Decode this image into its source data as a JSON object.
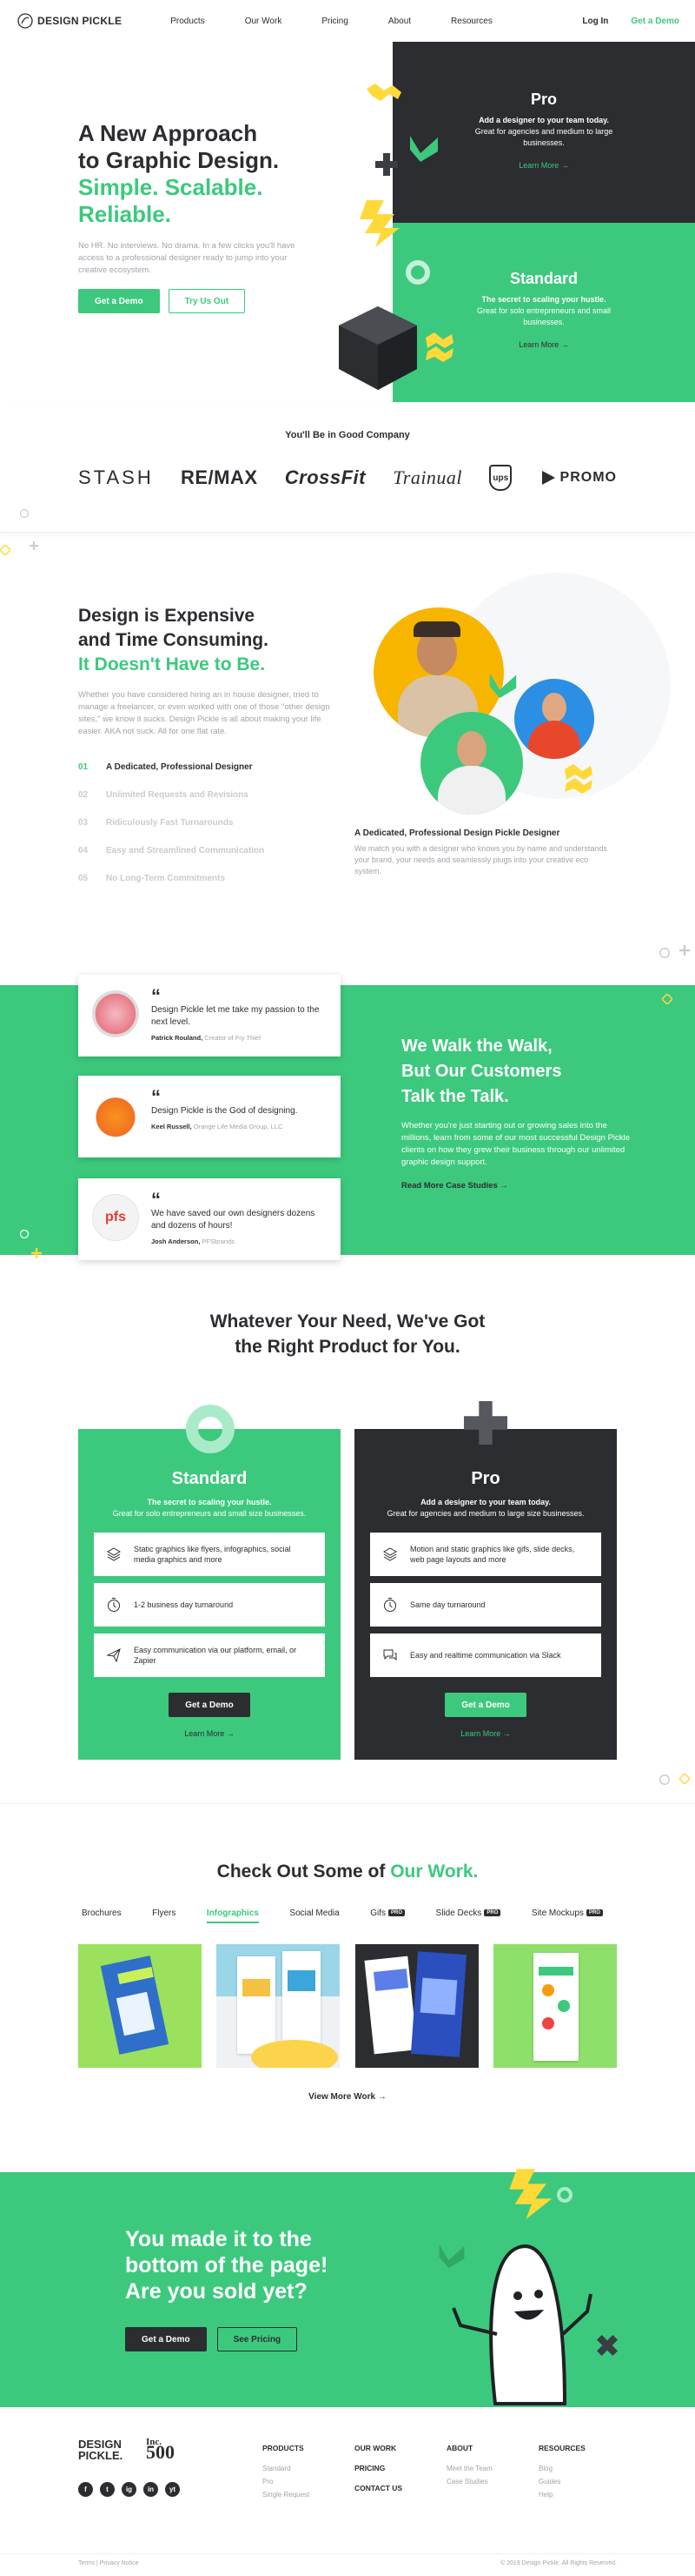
{
  "header": {
    "logo_text": "DESIGN PICKLE",
    "nav": [
      "Products",
      "Our Work",
      "Pricing",
      "About",
      "Resources"
    ],
    "login": "Log In",
    "get_demo": "Get a Demo"
  },
  "hero": {
    "title_line1": "A New Approach",
    "title_line2": "to Graphic Design.",
    "title_line3": "Simple. Scalable.",
    "title_line4": "Reliable.",
    "description": "No HR. No interviews. No drama. In a few clicks you'll have access to a professional designer ready to jump into your creative ecosystem.",
    "btn_demo": "Get a Demo",
    "btn_try": "Try Us Out",
    "pro": {
      "title": "Pro",
      "subtitle": "Add a designer to your team today.",
      "desc": "Great for agencies and medium to large businesses.",
      "link": "Learn More →"
    },
    "standard": {
      "title": "Standard",
      "subtitle": "The secret to scaling your hustle.",
      "desc": "Great for solo entrepreneurs and small businesses.",
      "link": "Learn More →"
    }
  },
  "company": {
    "heading": "You'll Be in Good Company",
    "logos": [
      "STASH",
      "RE/MAX",
      "CrossFit",
      "Trainual",
      "ups",
      "PROMO"
    ]
  },
  "expensive": {
    "title_line1": "Design is Expensive",
    "title_line2": "and Time Consuming.",
    "title_line3": "It Doesn't Have to Be.",
    "body": "Whether you have considered hiring an in house designer, tried to manage a freelancer, or even worked with one of those \"other design sites,\" we know it sucks. Design Pickle is all about making your life easier. AKA not suck. All for one flat rate.",
    "items": [
      {
        "num": "01",
        "text": "A Dedicated, Professional Designer"
      },
      {
        "num": "02",
        "text": "Unlimited Requests and Revisions"
      },
      {
        "num": "03",
        "text": "Ridiculously Fast Turnarounds"
      },
      {
        "num": "04",
        "text": "Easy and Streamlined Communication"
      },
      {
        "num": "05",
        "text": "No Long-Term Commitments"
      }
    ],
    "feature_title": "A Dedicated, Professional Design Pickle Designer",
    "feature_desc": "We match you with a designer who knows you by name and understands your brand, your needs and seamlessly plugs into your creative eco system."
  },
  "testimonials": [
    {
      "quote_mark": "“",
      "text": "Design Pickle let me take my passion to the next level.",
      "name": "Patrick Rouland,",
      "role": "Creator of Fry Thief"
    },
    {
      "quote_mark": "“",
      "text": "Design Pickle is the God of designing.",
      "name": "Keel Russell,",
      "role": "Orange Life Media Group, LLC"
    },
    {
      "quote_mark": "“",
      "text": "We have saved our own designers dozens and dozens of hours!",
      "name": "Josh Anderson,",
      "role": "PFSbrands"
    }
  ],
  "walk": {
    "title_line1": "We Walk the Walk,",
    "title_line2": "But Our Customers",
    "title_line3": "Talk the Talk.",
    "body": "Whether you're just starting out or growing sales into the millions, learn from some of our most successful Design Pickle clients on how they grew their business through our unlimited graphic design support.",
    "link": "Read More Case Studies →"
  },
  "products": {
    "title_line1": "Whatever Your Need, We've Got",
    "title_line2": "the Right Product for You.",
    "standard": {
      "title": "Standard",
      "subtitle": "The secret to scaling your hustle.",
      "desc": "Great for solo entrepreneurs and small size businesses.",
      "features": [
        "Static graphics like flyers, infographics, social media graphics and more",
        "1-2 business day turnaround",
        "Easy communication via our platform, email, or Zapier"
      ],
      "btn": "Get a Demo",
      "link": "Learn More →"
    },
    "pro": {
      "title": "Pro",
      "subtitle": "Add a designer to your team today.",
      "desc": "Great for agencies and medium to large size businesses.",
      "features": [
        "Motion and static graphics like gifs, slide decks, web page layouts and more",
        "Same day turnaround",
        "Easy and realtime communication via Slack"
      ],
      "btn": "Get a Demo",
      "link": "Learn More →"
    }
  },
  "work": {
    "title_prefix": "Check Out Some of ",
    "title_accent": "Our Work.",
    "tabs": [
      "Brochures",
      "Flyers",
      "Infographics",
      "Social Media",
      "Gifs",
      "Slide Decks",
      "Site Mockups"
    ],
    "pro_badge": "PRO",
    "view_more": "View More Work →"
  },
  "bottom": {
    "line1": "You made it to the",
    "line2": "bottom of the page!",
    "line3": "Are you sold yet?",
    "btn_demo": "Get a Demo",
    "btn_pricing": "See Pricing"
  },
  "footer": {
    "logo_line1": "DESIGN",
    "logo_line2": "PICKLE.",
    "inc_label": "Inc.",
    "inc_number": "500",
    "social": [
      "f",
      "t",
      "ig",
      "in",
      "yt"
    ],
    "cols": [
      {
        "heading": "PRODUCTS",
        "links": [
          "Standard",
          "Pro",
          "Single Request"
        ]
      },
      {
        "heading": "OUR WORK",
        "links": [
          "PRICING",
          "CONTACT US"
        ]
      },
      {
        "heading": "ABOUT",
        "links": [
          "Meet the Team",
          "Case Studies"
        ]
      },
      {
        "heading": "RESOURCES",
        "links": [
          "Blog",
          "Guides",
          "Help"
        ]
      }
    ],
    "terms": "Terms  |  Privacy Notice",
    "copyright": "© 2019 Design Pickle. All Rights Reserved."
  },
  "colors": {
    "green": "#3cc97d",
    "dark": "#2b2d31",
    "yellow": "#ffd93a"
  }
}
